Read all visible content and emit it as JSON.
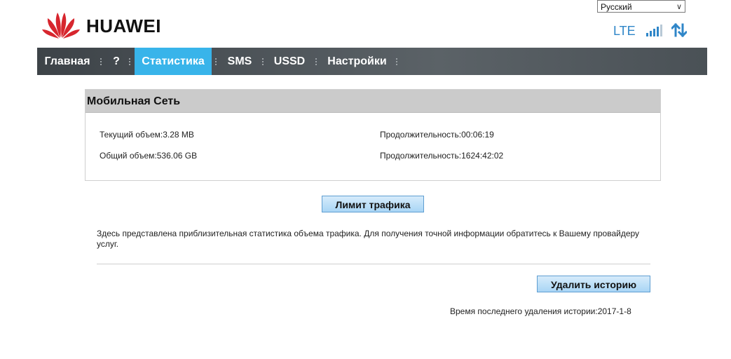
{
  "header": {
    "brand": "HUAWEI",
    "language": "Русский",
    "network_type": "LTE",
    "signal_bars": 4,
    "accent_color": "#2f86c8",
    "logo_color": "#d7262e"
  },
  "nav": {
    "items": [
      {
        "label": "Главная"
      },
      {
        "label": "?"
      },
      {
        "label": "Статистика"
      },
      {
        "label": "SMS"
      },
      {
        "label": "USSD"
      },
      {
        "label": "Настройки"
      }
    ],
    "active_index": 2,
    "active_color": "#38b4ea"
  },
  "panel": {
    "title": "Мобильная Сеть",
    "current_volume": "Текущий объем:3.28 MB",
    "current_duration": "Продолжительность:00:06:19",
    "total_volume": "Общий объем:536.06 GB",
    "total_duration": "Продолжительность:1624:42:02"
  },
  "buttons": {
    "traffic_limit": "Лимит трафика",
    "delete_history": "Удалить историю"
  },
  "note": "Здесь представлена приблизительная статистика объема трафика. Для получения точной информации обратитесь к Вашему провайдеру услуг.",
  "last_delete": "Время последнего удаления истории:2017-1-8"
}
